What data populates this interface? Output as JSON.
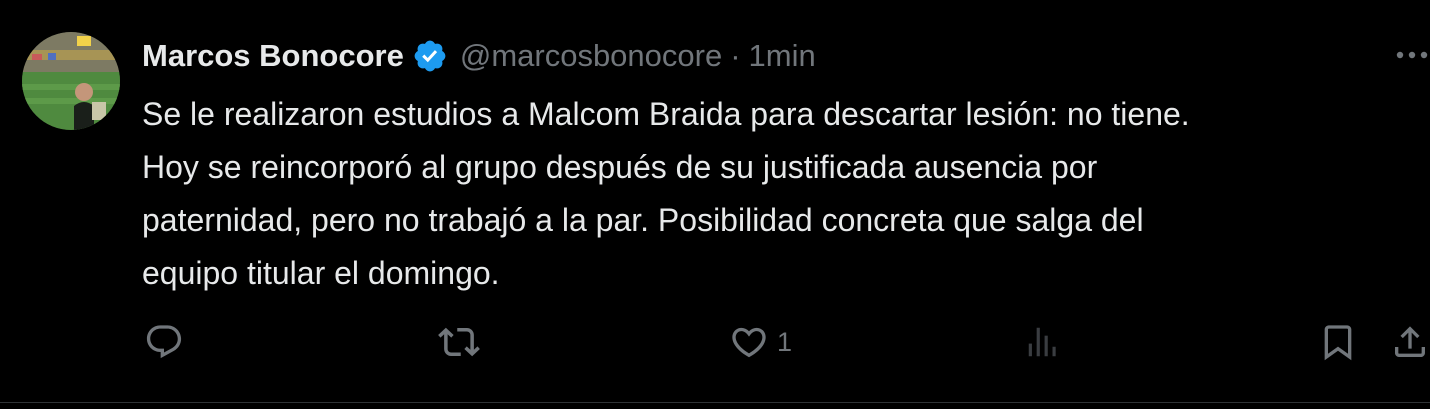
{
  "tweet": {
    "author": {
      "display_name": "Marcos Bonocore",
      "handle": "@marcosbonocore",
      "verified": true,
      "verified_icon": "verified-badge-icon",
      "avatar_icon": "avatar"
    },
    "separator": "·",
    "timestamp": "1min",
    "text": "Se le realizaron estudios a Malcom Braida para descartar lesión: no tiene.\nHoy se reincorporó al grupo después de su justificada ausencia por\npaternidad, pero no trabajó a la par. Posibilidad concreta que salga del\nequipo titular el domingo.",
    "actions": {
      "reply": {
        "icon": "reply-icon",
        "count": ""
      },
      "retweet": {
        "icon": "retweet-icon",
        "count": ""
      },
      "like": {
        "icon": "heart-icon",
        "count": "1"
      },
      "views": {
        "icon": "views-icon",
        "count": ""
      },
      "bookmark": {
        "icon": "bookmark-icon"
      },
      "share": {
        "icon": "share-icon"
      }
    },
    "more": {
      "icon": "more-icon"
    }
  },
  "colors": {
    "background": "#000000",
    "primary_text": "#e7e9ea",
    "secondary_text": "#71767b",
    "verified_blue": "#1d9bf0",
    "divider": "#2f3336"
  }
}
